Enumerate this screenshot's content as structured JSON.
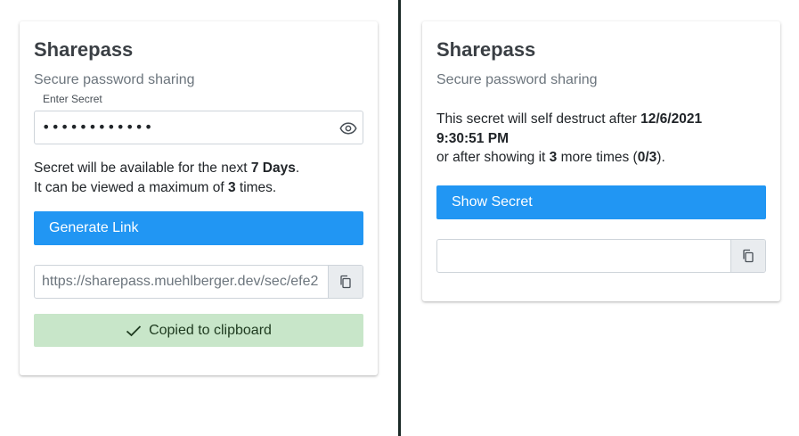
{
  "left": {
    "title": "Sharepass",
    "subtitle": "Secure password sharing",
    "secret_label": "Enter Secret",
    "secret_value": "••••••••••••",
    "availability_prefix": "Secret will be available for the next ",
    "availability_value": "7 Days",
    "availability_suffix": ".",
    "views_prefix": "It can be viewed a maximum of ",
    "views_value": "3",
    "views_suffix": " times.",
    "generate_label": "Generate Link",
    "link_value": "https://sharepass.muehlberger.dev/sec/efe2",
    "copied_label": "Copied to clipboard"
  },
  "right": {
    "title": "Sharepass",
    "subtitle": "Secure password sharing",
    "destruct_prefix": "This secret will self destruct after ",
    "destruct_date": "12/6/2021",
    "destruct_time": "9:30:51 PM",
    "showing_prefix": "or after showing it ",
    "showing_count": "3",
    "showing_mid": " more times (",
    "showing_ratio": "0/3",
    "showing_suffix": ").",
    "show_label": "Show Secret",
    "secret_output": ""
  },
  "colors": {
    "primary": "#2196f3",
    "success_bg": "#c8e6c9",
    "divider": "#1b2a27"
  }
}
